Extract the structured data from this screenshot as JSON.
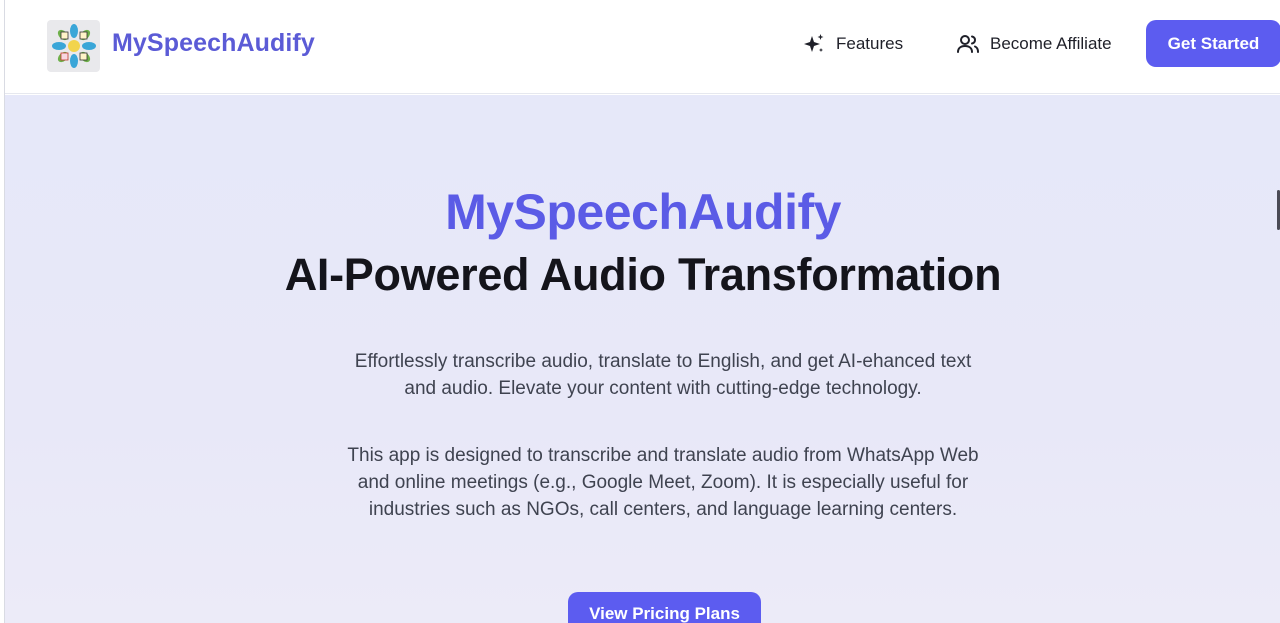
{
  "header": {
    "brand": "MySpeechAudify",
    "logo_icon": "app-logo-icon",
    "nav": [
      {
        "label": "Features",
        "icon": "sparkles-icon"
      },
      {
        "label": "Become Affiliate",
        "icon": "users-icon"
      }
    ],
    "cta_label": "Get Started"
  },
  "hero": {
    "title": "MySpeechAudify",
    "subtitle": "AI-Powered Audio Transformation",
    "paragraph1": "Effortlessly transcribe audio, translate to English, and get AI-ehanced text and audio. Elevate your content with cutting-edge technology.",
    "paragraph2": "This app is designed to transcribe and translate audio from WhatsApp Web and online meetings (e.g., Google Meet, Zoom). It is especially useful for industries such as NGOs, call centers, and language learning centers.",
    "pricing_button": "View Pricing Plans"
  },
  "colors": {
    "brand": "#5b5bd6",
    "button": "#5c5cf0",
    "hero_background": "#e7e8f9",
    "heading": "#14141b"
  }
}
